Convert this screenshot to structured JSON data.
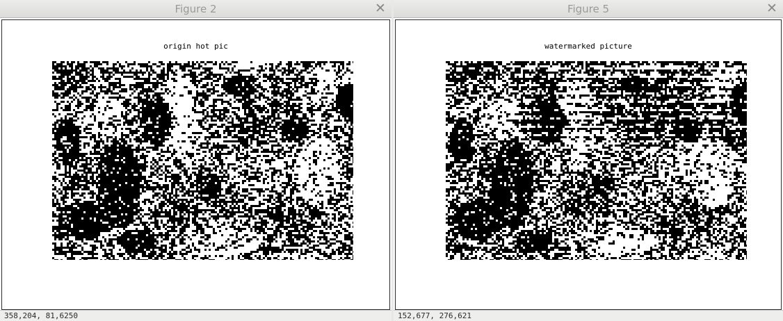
{
  "figures": [
    {
      "window_title": "Figure 2",
      "close_glyph": "✕",
      "plot_title": "origin hot pic",
      "status": "358,204,  81,6250",
      "image": "binary-threshold-photo"
    },
    {
      "window_title": "Figure 5",
      "close_glyph": "✕",
      "plot_title": "watermarked picture",
      "status": "152,677,  276,621",
      "image": "binary-threshold-photo-with-watermark-stripes"
    }
  ],
  "icons": {
    "close": "close-icon"
  }
}
